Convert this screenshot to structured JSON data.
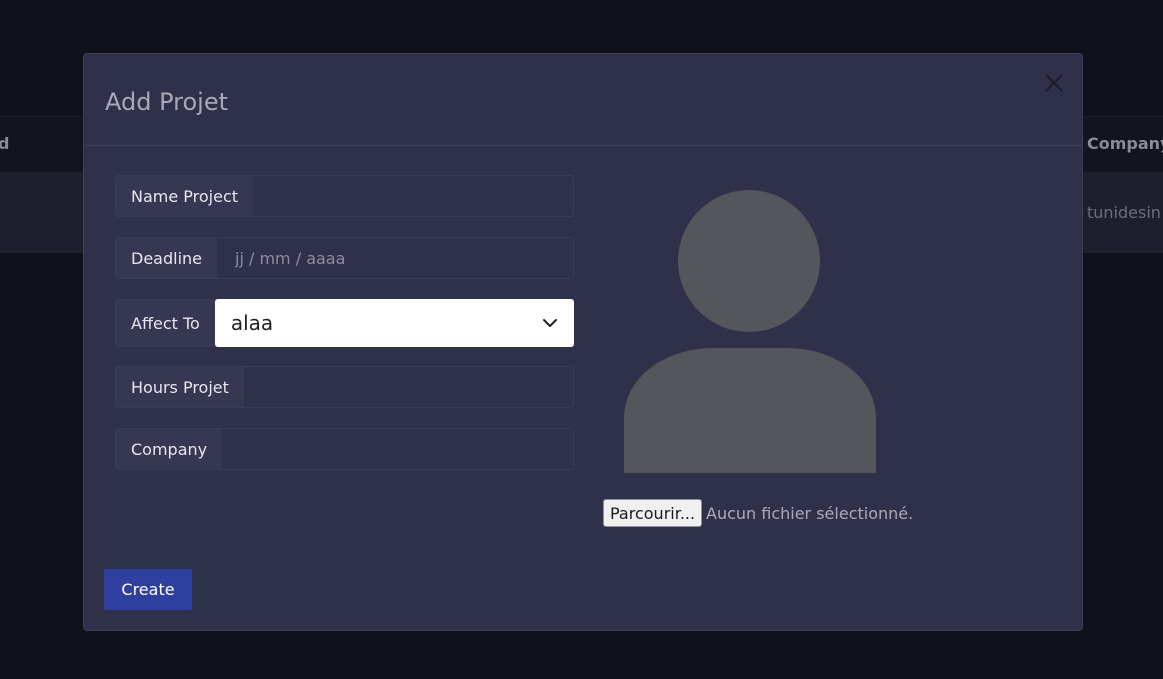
{
  "background": {
    "columns": {
      "left_partial": "d",
      "company": "Company"
    },
    "row": {
      "company": "tunidesin"
    }
  },
  "modal": {
    "title": "Add Projet",
    "fields": {
      "name_project": {
        "label": "Name Project",
        "value": ""
      },
      "deadline": {
        "label": "Deadline",
        "placeholder": "jj / mm / aaaa"
      },
      "affect_to": {
        "label": "Affect To",
        "selected": "alaa"
      },
      "hours_projet": {
        "label": "Hours Projet",
        "value": ""
      },
      "company": {
        "label": "Company",
        "value": ""
      }
    },
    "file": {
      "button_label": "Parcourir...",
      "status": "Aucun fichier sélectionné."
    },
    "create_label": "Create"
  },
  "colors": {
    "page_bg": "#11111b",
    "modal_bg": "#2f3049",
    "primary_button": "#2e3fa0",
    "avatar_fill": "#53565a"
  },
  "icons": {
    "close": "close-icon",
    "chevron": "chevron-down-icon",
    "avatar": "user-placeholder-icon"
  }
}
